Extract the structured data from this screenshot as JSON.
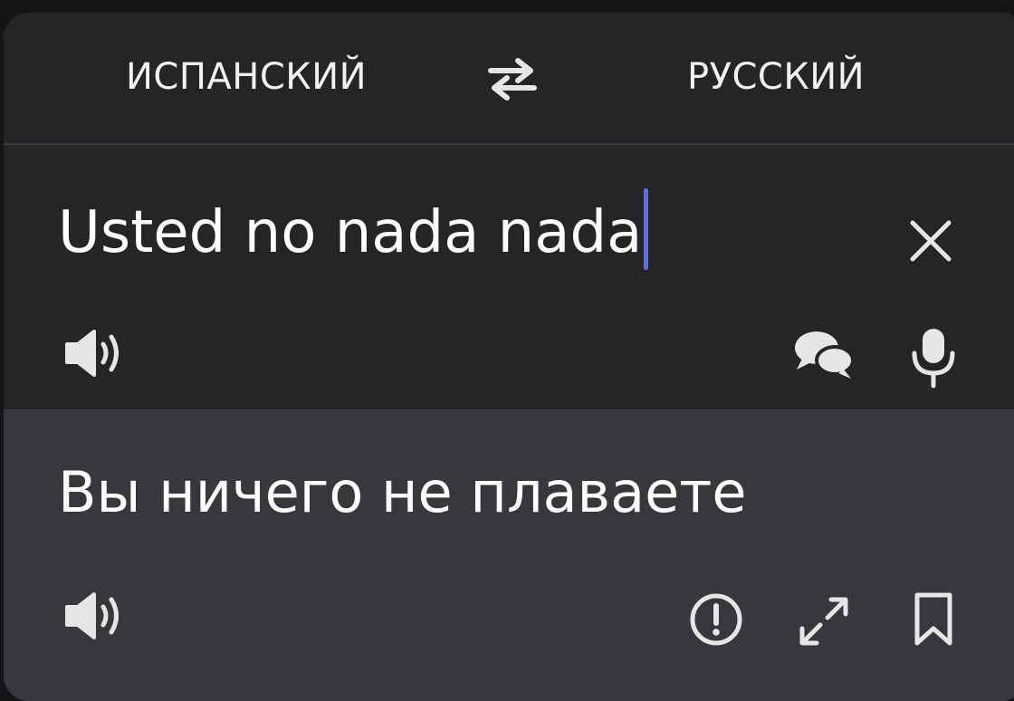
{
  "languages": {
    "source": "ИСПАНСКИЙ",
    "target": "РУССКИЙ"
  },
  "input": {
    "text": "Usted no nada nada"
  },
  "output": {
    "text": "Вы ничего не плаваете"
  },
  "icons": {
    "swap": "swap-arrows-icon",
    "clear": "close-icon",
    "source_speak": "speaker-icon",
    "dialog": "chat-bubbles-icon",
    "mic": "microphone-icon",
    "target_speak": "speaker-icon",
    "report": "exclamation-circle-icon",
    "fullscreen": "expand-icon",
    "bookmark": "bookmark-icon"
  },
  "colors": {
    "background": "#151517",
    "card": "#252528",
    "output_panel": "#38383c",
    "text": "#ffffff",
    "icon": "#e0e0e0",
    "caret": "#5b6cf0"
  }
}
